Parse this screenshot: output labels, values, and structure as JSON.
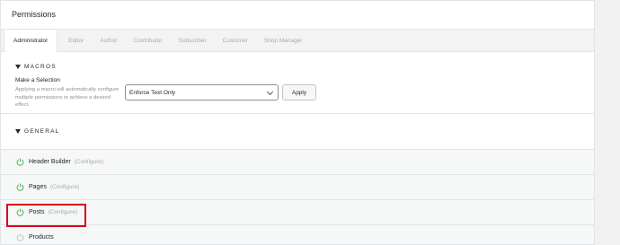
{
  "panel": {
    "title": "Permissions"
  },
  "tabs": [
    {
      "label": "Administrator",
      "active": true
    },
    {
      "label": "Editor"
    },
    {
      "label": "Author"
    },
    {
      "label": "Contributor"
    },
    {
      "label": "Subscriber"
    },
    {
      "label": "Customer"
    },
    {
      "label": "Shop Manager"
    }
  ],
  "macros": {
    "title": "MACROS",
    "make_label": "Make a Selection",
    "help_text": "Applying a macro will automatically configure multiple permissions to achieve a desired effect.",
    "select_value": "Enforce Text Only",
    "apply_label": "Apply"
  },
  "general": {
    "title": "GENERAL",
    "items": [
      {
        "label": "Header Builder",
        "configure": "(Configure)",
        "enabled": true
      },
      {
        "label": "Pages",
        "configure": "(Configure)",
        "enabled": true
      },
      {
        "label": "Posts",
        "configure": "(Configure)",
        "enabled": true
      },
      {
        "label": "Products",
        "configure": "",
        "enabled": false
      }
    ]
  },
  "colors": {
    "enabled_power": "#46b450",
    "disabled_power": "#c3c4c7",
    "highlight": "#d9001b"
  }
}
